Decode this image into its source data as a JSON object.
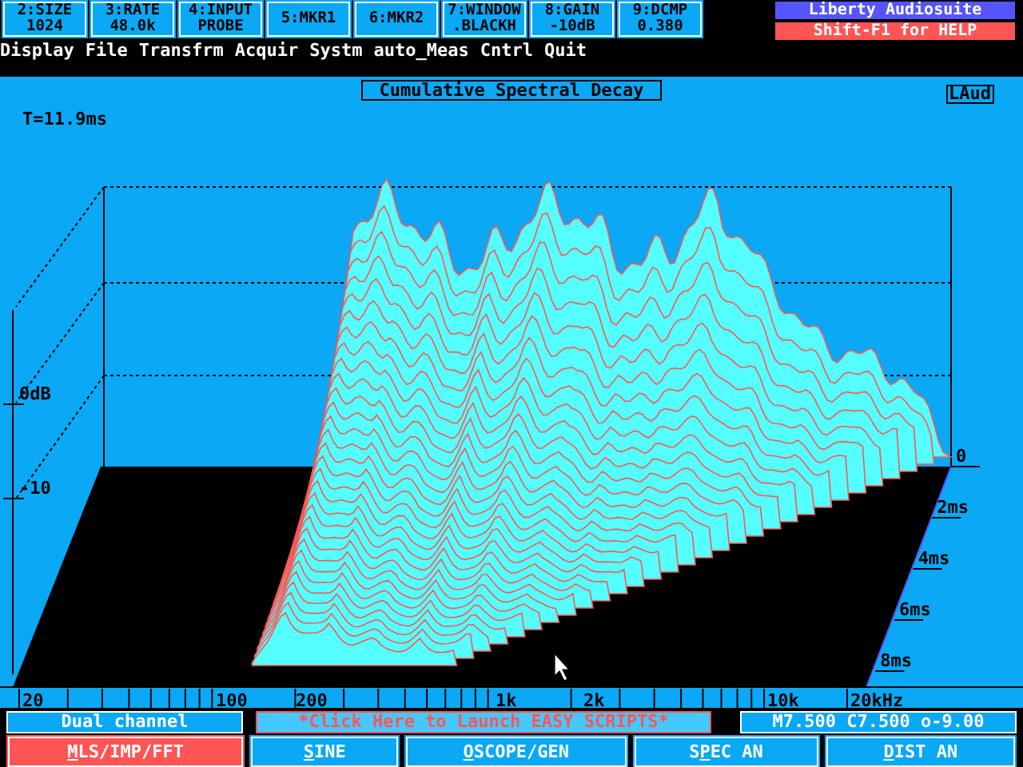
{
  "function_keys": [
    {
      "label": "2:SIZE",
      "value": "1024"
    },
    {
      "label": "3:RATE",
      "value": "48.0k"
    },
    {
      "label": "4:INPUT",
      "value": "PROBE"
    },
    {
      "label": "5:MKR1"
    },
    {
      "label": "6:MKR2"
    },
    {
      "label": "7:WINDOW",
      "value": ".BLACKH"
    },
    {
      "label": "8:GAIN",
      "value": "-10dB"
    },
    {
      "label": "9:DCMP",
      "value": "0.380"
    }
  ],
  "brand": "Liberty Audiosuite",
  "help": "Shift-F1 for HELP",
  "menu": [
    "Display",
    "File",
    "Transfrm",
    "Acquir",
    "Systm",
    "auto_Meas",
    "Cntrl",
    "Quit"
  ],
  "plot": {
    "title": "Cumulative Spectral Decay",
    "tag": "LAud",
    "time_readout": "T=11.9ms",
    "db_labels": [
      "0dB",
      "-10"
    ],
    "time_labels": [
      "0",
      "2ms",
      "4ms",
      "6ms",
      "8ms"
    ],
    "freq_labels": [
      "20",
      "100",
      "200",
      "1k",
      "2k",
      "10k",
      "20kHz"
    ]
  },
  "status": {
    "channel": "Dual channel",
    "scripts_link": "*Click Here to Launch EASY SCRIPTS*",
    "readout": "M7.500 C7.500 o-9.00"
  },
  "modes": [
    {
      "hotkey": "M",
      "after": "LS/IMP/FFT",
      "selected": true
    },
    {
      "hotkey": "S",
      "after": "INE",
      "selected": false
    },
    {
      "hotkey": "O",
      "after": "SCOPE/GEN",
      "selected": false
    },
    {
      "before": "S",
      "hotkey": "P",
      "after": "EC AN",
      "selected": false
    },
    {
      "hotkey": "D",
      "after": "IST AN",
      "selected": false
    }
  ]
}
